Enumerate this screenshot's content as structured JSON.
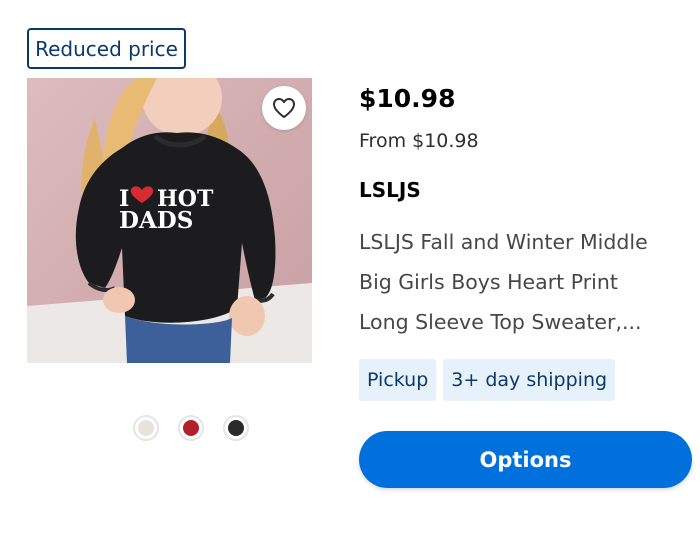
{
  "badge": {
    "label": "Reduced price"
  },
  "product": {
    "image_print_text": [
      "I",
      "HOT",
      "DADS"
    ],
    "price": "$10.98",
    "from_price": "From $10.98",
    "brand": "LSLJS",
    "title_lines": [
      "LSLJS Fall and Winter Middle",
      "Big Girls Boys Heart Print",
      "Long Sleeve Top Sweater,..."
    ]
  },
  "favorite": {
    "icon": "heart-outline-icon"
  },
  "swatches": [
    {
      "name": "white-variant",
      "color": "#e8e2dd"
    },
    {
      "name": "red-variant",
      "color": "#b3202a"
    },
    {
      "name": "black-variant",
      "color": "#2a2a2a"
    }
  ],
  "fulfillment_tags": [
    "Pickup",
    "3+ day shipping"
  ],
  "options_button": {
    "label": "Options"
  },
  "colors": {
    "accent": "#0071dc",
    "badge_border": "#0b3a6a",
    "tag_background": "#e6f1fc",
    "heart_print": "#d62b33"
  }
}
